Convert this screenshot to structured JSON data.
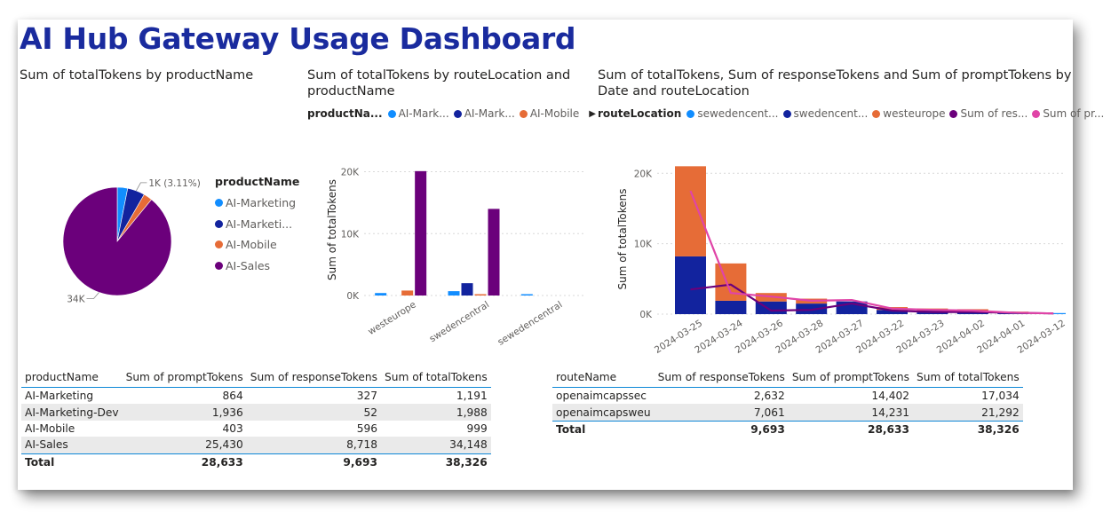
{
  "dashboard": {
    "title": "AI Hub Gateway Usage Dashboard"
  },
  "colors": {
    "ai_marketing": "#118dff",
    "ai_marketing_dev": "#12239e",
    "ai_mobile": "#e66c37",
    "ai_sales": "#6b007b",
    "sewedencentral": "#118dff",
    "swedencentral": "#12239e",
    "westeurope": "#e66c37",
    "response_line": "#6b007b",
    "prompt_line": "#e044a7"
  },
  "pie": {
    "title": "Sum of totalTokens by productName",
    "legend_title": "productName",
    "legend_items": [
      "AI-Marketing",
      "AI-Marketi...",
      "AI-Mobile",
      "AI-Sales"
    ],
    "label_small": "1K (3.11%)",
    "label_big_value": "34K",
    "label_big_pct": "(89.1%)"
  },
  "bar": {
    "title_line1": "Sum of totalTokens by routeLocation and",
    "title_line2": "productName",
    "legend_title": "productNa...",
    "legend_items": [
      "AI-Mark...",
      "AI-Mark...",
      "AI-Mobile"
    ],
    "ylabel": "Sum of totalTokens",
    "xlabel": "routeLocation",
    "yticks": [
      "20K",
      "10K",
      "0K"
    ]
  },
  "combo": {
    "title_line1": "Sum of totalTokens, Sum of responseTokens and Sum of promptTokens by",
    "title_line2": "Date and routeLocation",
    "legend_title": "routeLocation",
    "legend_items": [
      "sewedencent...",
      "swedencent...",
      "westeurope",
      "Sum of res...",
      "Sum of pr..."
    ],
    "ylabel": "Sum of totalTokens",
    "xlabel": "Date",
    "yticks": [
      "20K",
      "10K",
      "0K"
    ]
  },
  "chart_data": [
    {
      "type": "pie",
      "title": "Sum of totalTokens by productName",
      "legend_title": "productName",
      "slices": [
        {
          "name": "AI-Marketing",
          "value": 1191
        },
        {
          "name": "AI-Marketing-Dev",
          "value": 1988
        },
        {
          "name": "AI-Mobile",
          "value": 999
        },
        {
          "name": "AI-Sales",
          "value": 34148
        }
      ],
      "data_labels": [
        "1K (3.11%)",
        "34K (89.1%)"
      ]
    },
    {
      "type": "bar",
      "title": "Sum of totalTokens by routeLocation and productName",
      "categories": [
        "westeurope",
        "swedencentral",
        "sewedencentral"
      ],
      "series": [
        {
          "name": "AI-Marketing",
          "values": [
            400,
            700,
            100
          ]
        },
        {
          "name": "AI-Marketing-Dev",
          "values": [
            0,
            1988,
            0
          ]
        },
        {
          "name": "AI-Mobile",
          "values": [
            800,
            200,
            0
          ]
        },
        {
          "name": "AI-Sales",
          "values": [
            20100,
            14000,
            0
          ]
        }
      ],
      "xlabel": "routeLocation",
      "ylabel": "Sum of totalTokens",
      "ylim": [
        0,
        21800
      ],
      "yticks": [
        0,
        10000,
        20000
      ],
      "grid": true
    },
    {
      "type": "bar",
      "stacked": true,
      "title": "Sum of totalTokens, Sum of responseTokens and Sum of promptTokens by Date and routeLocation",
      "categories": [
        "2024-03-25",
        "2024-03-24",
        "2024-03-26",
        "2024-03-28",
        "2024-03-27",
        "2024-03-22",
        "2024-03-23",
        "2024-04-02",
        "2024-04-01",
        "2024-03-12"
      ],
      "series": [
        {
          "name": "sewedencentral",
          "values": [
            0,
            0,
            0,
            0,
            0,
            0,
            0,
            0,
            0,
            100
          ]
        },
        {
          "name": "swedencentral",
          "values": [
            8200,
            1900,
            1800,
            1500,
            1800,
            600,
            500,
            300,
            200,
            0
          ]
        },
        {
          "name": "westeurope",
          "values": [
            12800,
            5300,
            1200,
            700,
            0,
            400,
            300,
            400,
            100,
            0
          ]
        }
      ],
      "lines": [
        {
          "name": "Sum of responseTokens",
          "values": [
            3500,
            4200,
            500,
            600,
            1500,
            500,
            300,
            300,
            200,
            100
          ]
        },
        {
          "name": "Sum of promptTokens",
          "values": [
            17500,
            3000,
            2500,
            1900,
            2000,
            800,
            600,
            500,
            200,
            100
          ]
        }
      ],
      "xlabel": "Date",
      "ylabel": "Sum of totalTokens",
      "ylim": [
        0,
        21800
      ],
      "yticks": [
        0,
        10000,
        20000
      ],
      "grid": true
    },
    {
      "type": "table",
      "columns": [
        "productName",
        "Sum of promptTokens",
        "Sum of responseTokens",
        "Sum of totalTokens"
      ],
      "rows": [
        [
          "AI-Marketing",
          "864",
          "327",
          "1,191"
        ],
        [
          "AI-Marketing-Dev",
          "1,936",
          "52",
          "1,988"
        ],
        [
          "AI-Mobile",
          "403",
          "596",
          "999"
        ],
        [
          "AI-Sales",
          "25,430",
          "8,718",
          "34,148"
        ]
      ],
      "total": [
        "Total",
        "28,633",
        "9,693",
        "38,326"
      ]
    },
    {
      "type": "table",
      "columns": [
        "routeName",
        "Sum of responseTokens",
        "Sum of promptTokens",
        "Sum of totalTokens"
      ],
      "rows": [
        [
          "openaimcapssec",
          "2,632",
          "14,402",
          "17,034"
        ],
        [
          "openaimcapsweu",
          "7,061",
          "14,231",
          "21,292"
        ]
      ],
      "total": [
        "Total",
        "9,693",
        "28,633",
        "38,326"
      ]
    }
  ]
}
